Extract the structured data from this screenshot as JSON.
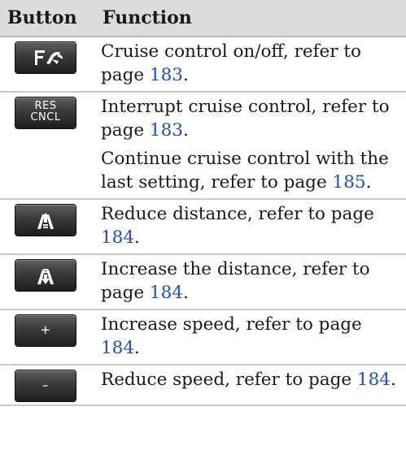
{
  "header": {
    "button": "Button",
    "function": "Function"
  },
  "rows": [
    {
      "icon": "cruise-control-icon",
      "lines": [
        {
          "text": "Cruise control on/off, refer to page ",
          "page": "183",
          "end": "."
        }
      ]
    },
    {
      "icon": "res-cncl-icon",
      "button_text": {
        "top": "RES",
        "bottom": "CNCL"
      },
      "lines": [
        {
          "text": "Interrupt cruise control, refer to page ",
          "page": "183",
          "end": "."
        },
        {
          "text": "Continue cruise control with the last setting, refer to page ",
          "page": "185",
          "end": "."
        }
      ]
    },
    {
      "icon": "distance-reduce-icon",
      "lines": [
        {
          "text": "Reduce distance, refer to page ",
          "page": "184",
          "end": "."
        }
      ]
    },
    {
      "icon": "distance-increase-icon",
      "lines": [
        {
          "text": "Increase the distance, refer to page ",
          "page": "184",
          "end": "."
        }
      ]
    },
    {
      "icon": "plus-icon",
      "button_text": "+",
      "lines": [
        {
          "text": "Increase speed, refer to page ",
          "page": "184",
          "end": "."
        }
      ]
    },
    {
      "icon": "minus-icon",
      "button_text": "–",
      "lines": [
        {
          "text": "Reduce speed, refer to page ",
          "page": "184",
          "end": "."
        }
      ]
    }
  ]
}
